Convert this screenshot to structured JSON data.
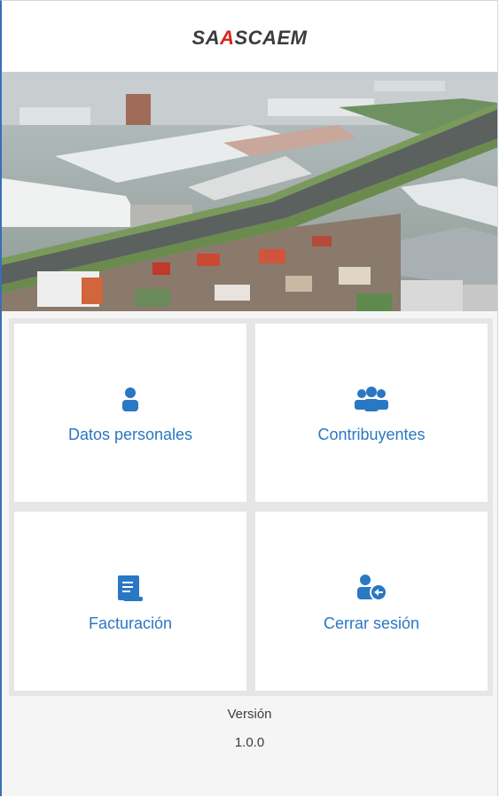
{
  "header": {
    "logo_part1": "SA",
    "logo_part2": "A",
    "logo_part3": "SCAEM"
  },
  "hero": {
    "description_icon": "aerial-city-photo"
  },
  "menu": {
    "tiles": [
      {
        "label": "Datos personales",
        "icon": "person-icon"
      },
      {
        "label": "Contribuyentes",
        "icon": "group-icon"
      },
      {
        "label": "Facturación",
        "icon": "document-icon"
      },
      {
        "label": "Cerrar sesión",
        "icon": "logout-user-icon"
      }
    ]
  },
  "footer": {
    "version_label": "Versión",
    "version_value": "1.0.0"
  },
  "colors": {
    "accent": "#2a77c4",
    "brand_red": "#d9251c",
    "brand_dark": "#3b3b3b"
  }
}
